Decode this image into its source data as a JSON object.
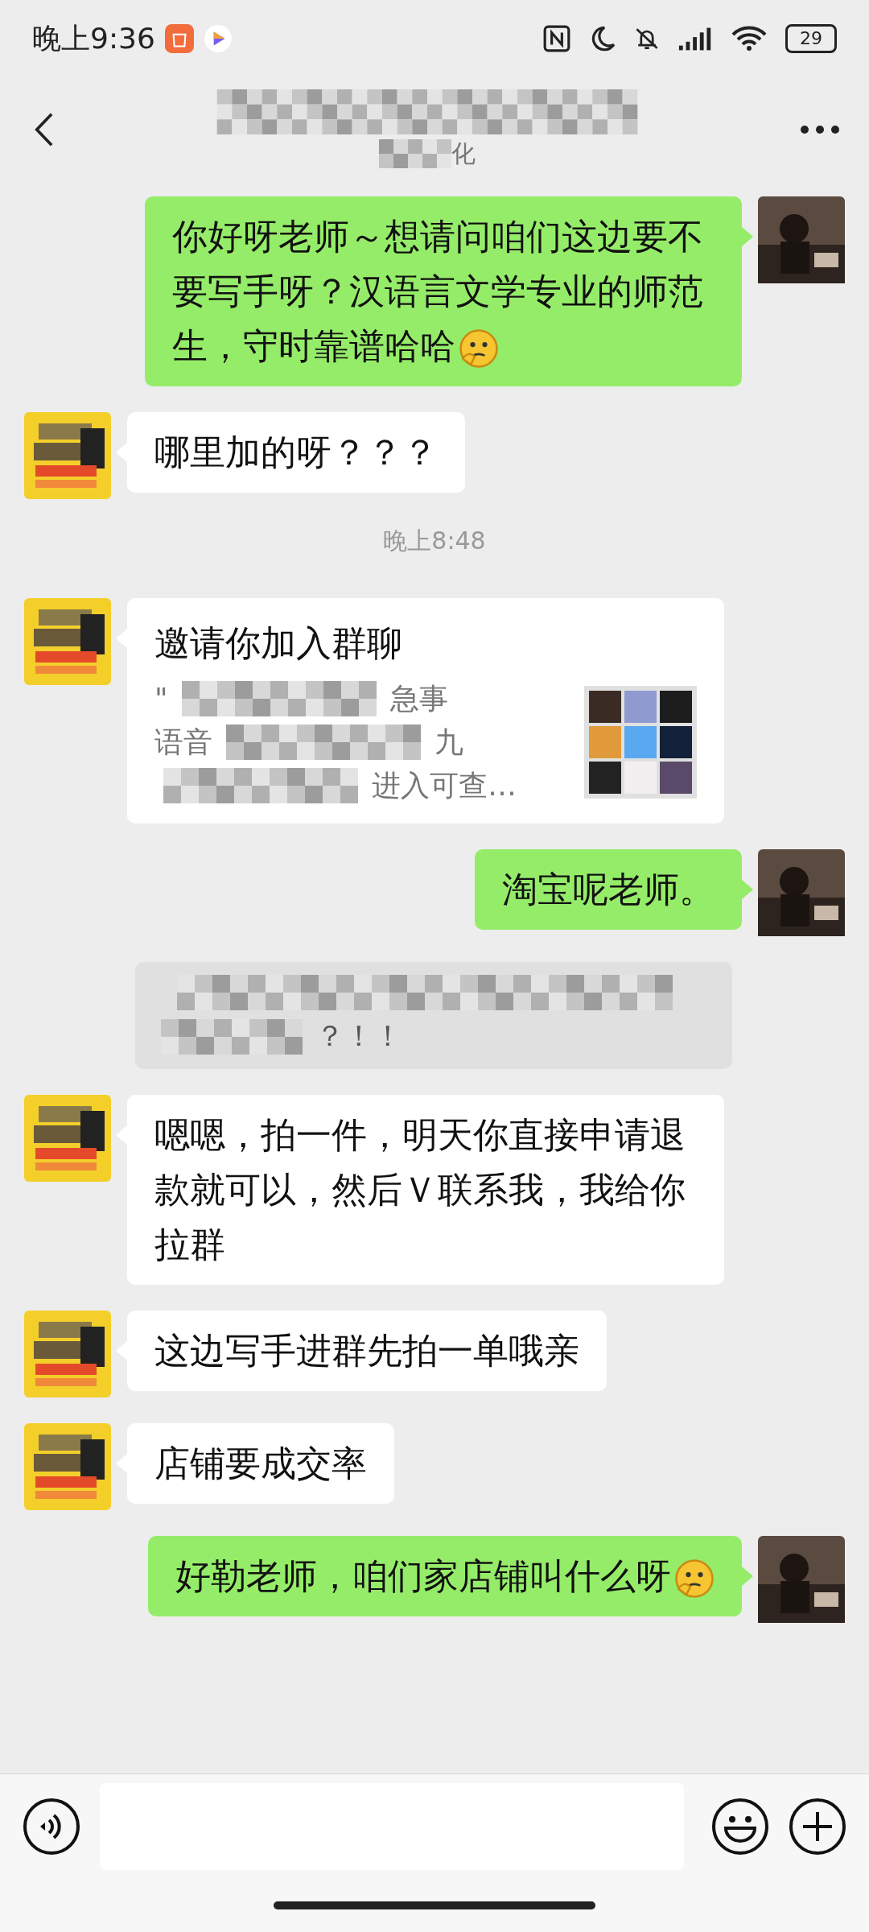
{
  "status_bar": {
    "time": "晚上9:36",
    "battery": "29"
  },
  "header": {
    "subtitle_visible": "化"
  },
  "messages": [
    {
      "kind": "text",
      "outgoing": true,
      "text": "你好呀老师～想请问咱们这边要不要写手呀？汉语言文学专业的师范生，守时靠谱哈哈",
      "emoji": true
    },
    {
      "kind": "text",
      "outgoing": false,
      "text": "哪里加的呀？？？",
      "emoji": false
    },
    {
      "kind": "time",
      "text": "晚上8:48"
    },
    {
      "kind": "invite",
      "outgoing": false,
      "title": "邀请你加入群聊",
      "lines": [
        {
          "before": "\"",
          "after": "急事"
        },
        {
          "before": "语音",
          "after": "九"
        },
        {
          "after": "进入可查…"
        }
      ]
    },
    {
      "kind": "text",
      "outgoing": true,
      "text": "淘宝呢老师。",
      "emoji": false
    },
    {
      "kind": "masked",
      "text": "？！！"
    },
    {
      "kind": "text",
      "outgoing": false,
      "text": "嗯嗯，拍一件，明天你直接申请退款就可以，然后Ｖ联系我，我给你拉群",
      "emoji": false
    },
    {
      "kind": "text",
      "outgoing": false,
      "text": "这边写手进群先拍一单哦亲",
      "emoji": false
    },
    {
      "kind": "text",
      "outgoing": false,
      "text": "店铺要成交率",
      "emoji": false
    },
    {
      "kind": "text",
      "outgoing": true,
      "text": "好勒老师，咱们家店铺叫什么呀",
      "emoji": true
    }
  ]
}
